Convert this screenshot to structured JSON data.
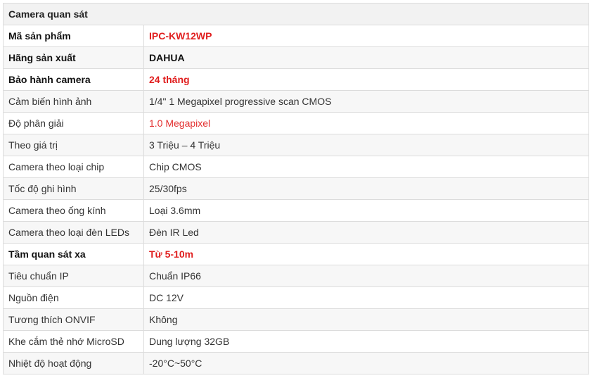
{
  "table": {
    "title": "Camera quan sát",
    "rows": [
      {
        "label": "Mã sản phẩm",
        "value": "IPC-KW12WP"
      },
      {
        "label": "Hãng sản xuất",
        "value": "DAHUA"
      },
      {
        "label": "Bảo hành camera",
        "value": "24 tháng"
      },
      {
        "label": "Cảm biến hình ảnh",
        "value": "1/4\" 1 Megapixel progressive scan CMOS"
      },
      {
        "label": "Độ phân giải",
        "value": "1.0 Megapixel"
      },
      {
        "label": "Theo giá trị",
        "value": "3 Triệu – 4 Triệu"
      },
      {
        "label": "Camera theo loại chip",
        "value": "Chip CMOS"
      },
      {
        "label": "Tốc độ ghi hình",
        "value": "25/30fps"
      },
      {
        "label": "Camera theo ống kính",
        "value": "Loại 3.6mm"
      },
      {
        "label": "Camera theo loại đèn LEDs",
        "value": "Đèn IR Led"
      },
      {
        "label": "Tầm quan sát xa",
        "value": "Từ 5-10m"
      },
      {
        "label": "Tiêu chuẩn IP",
        "value": "Chuẩn IP66"
      },
      {
        "label": "Nguồn điện",
        "value": "DC 12V"
      },
      {
        "label": "Tương thích ONVIF",
        "value": "Không"
      },
      {
        "label": "Khe cắm thẻ nhớ MicroSD",
        "value": "Dung lượng 32GB"
      },
      {
        "label": "Nhiệt độ hoạt động",
        "value": "-20°C~50°C"
      }
    ]
  },
  "colors": {
    "highlight_red": "#e01e1e",
    "border": "#dcdcdc",
    "header_bg": "#f2f2f2"
  }
}
